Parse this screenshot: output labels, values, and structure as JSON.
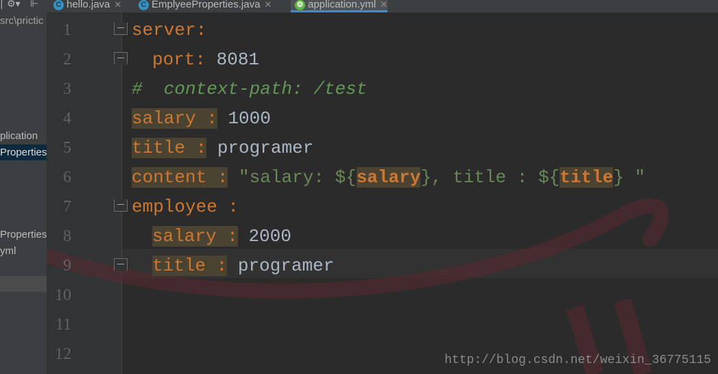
{
  "sidebar": {
    "path_fragment": "src\\prictic",
    "items": [
      {
        "label": "plication"
      },
      {
        "label": "Properties"
      },
      {
        "label": "Properties"
      },
      {
        "label": "yml"
      }
    ]
  },
  "tabs": [
    {
      "label": "hello.java",
      "icon": "c"
    },
    {
      "label": "EmplyeeProperties.java",
      "icon": "c"
    },
    {
      "label": "application.yml",
      "icon": "yml"
    }
  ],
  "line_numbers": [
    "1",
    "2",
    "3",
    "4",
    "5",
    "6",
    "7",
    "8",
    "9",
    "10",
    "11",
    "12"
  ],
  "code": {
    "l1_key": "server:",
    "l2_key": "port:",
    "l2_val": "8081",
    "l3_comment": "#  context-path: /test",
    "l4_key": "salary :",
    "l4_val": "1000",
    "l5_key": "title :",
    "l5_val": "programer",
    "l6_key": "content :",
    "l6_str_a": "\"salary: ${",
    "l6_ref_a": "salary",
    "l6_str_b": "}, title : ${",
    "l6_ref_b": "title",
    "l6_str_c": "} \"",
    "l7_key": "employee :",
    "l8_key": "salary :",
    "l8_val": "2000",
    "l9_key": "title :",
    "l9_val": "programer"
  },
  "watermark": "http://blog.csdn.net/weixin_36775115"
}
